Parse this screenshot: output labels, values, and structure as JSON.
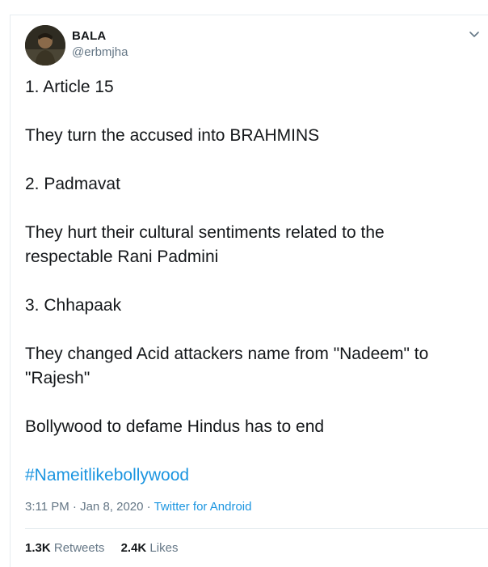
{
  "tweet": {
    "author": {
      "display_name": "BALA",
      "handle": "@erbmjha"
    },
    "paragraphs": [
      "1. Article 15",
      "They turn the accused into BRAHMINS",
      "2. Padmavat",
      "They hurt their cultural sentiments related to the respectable Rani Padmini",
      "3. Chhapaak",
      "They changed Acid attackers name from \"Nadeem\" to \"Rajesh\"",
      "Bollywood to defame Hindus has to end"
    ],
    "hashtag": "#Nameitlikebollywood",
    "time": "3:11 PM",
    "separator": "·",
    "date": "Jan 8, 2020",
    "source": "Twitter for Android",
    "stats": {
      "retweets_count": "1.3K",
      "retweets_label": "Retweets",
      "likes_count": "2.4K",
      "likes_label": "Likes"
    },
    "colors": {
      "link": "#1b95e0",
      "text": "#14171a",
      "muted": "#657786",
      "border": "#e6ecf0"
    },
    "icons": {
      "menu": "chevron-down-icon"
    }
  }
}
